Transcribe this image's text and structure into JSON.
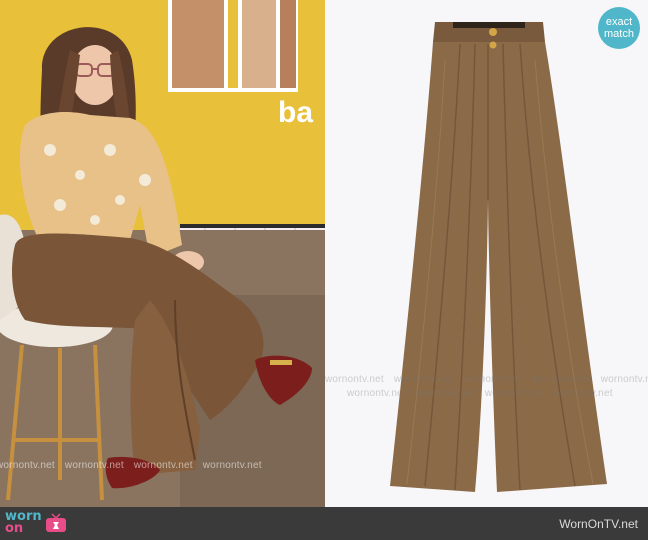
{
  "left_photo": {
    "sign_text": "ba",
    "watermark": [
      "wornontv.net",
      "wornontv.net",
      "wornontv.net",
      "wornontv.net"
    ]
  },
  "right_photo": {
    "watermark": [
      "wornontv.net",
      "wornontv.net",
      "wornontv.net",
      "wornontv.net",
      "wornontv.net"
    ]
  },
  "badge": {
    "line1": "exact",
    "line2": "match"
  },
  "footer": {
    "logo_line1": "worn",
    "logo_line2": "on",
    "site_name": "WornOnTV.net"
  },
  "colors": {
    "badge_bg": "#4fb7c9",
    "logo_pink": "#e84d8a",
    "trouser_brown": "#8b6a48",
    "backdrop_yellow": "#e9c33a"
  }
}
